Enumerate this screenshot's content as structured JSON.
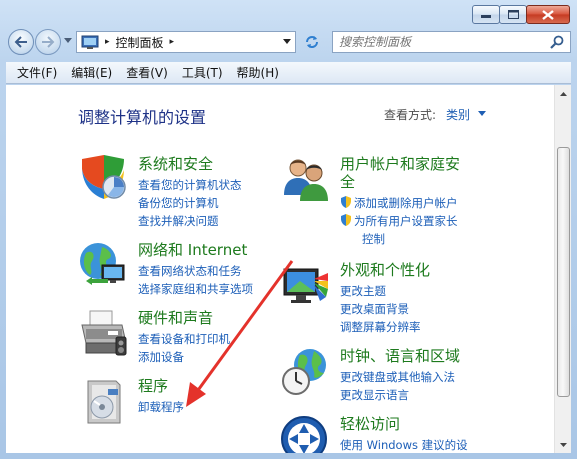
{
  "window": {
    "nav": {
      "back": "back",
      "forward": "forward"
    },
    "address": {
      "crumb": "控制面板",
      "separator": "▸"
    },
    "search": {
      "placeholder": "搜索控制面板"
    }
  },
  "menubar": [
    {
      "label": "文件(F)"
    },
    {
      "label": "编辑(E)"
    },
    {
      "label": "查看(V)"
    },
    {
      "label": "工具(T)"
    },
    {
      "label": "帮助(H)"
    }
  ],
  "content": {
    "title": "调整计算机的设置",
    "view_by_label": "查看方式:",
    "view_by_value": "类别",
    "categories": [
      {
        "title": "系统和安全",
        "icon": "shield-system-icon",
        "links": [
          "查看您的计算机状态",
          "备份您的计算机",
          "查找并解决问题"
        ]
      },
      {
        "title": "网络和 Internet",
        "icon": "network-globe-icon",
        "links": [
          "查看网络状态和任务",
          "选择家庭组和共享选项"
        ]
      },
      {
        "title": "硬件和声音",
        "icon": "printer-icon",
        "links": [
          "查看设备和打印机",
          "添加设备"
        ]
      },
      {
        "title": "程序",
        "icon": "programs-icon",
        "links": [
          "卸载程序"
        ]
      },
      {
        "title_line1": "用户帐户和家庭安",
        "title_line2": "全",
        "icon": "users-icon",
        "links": [
          "添加或删除用户帐户",
          "为所有用户设置家长",
          "控制"
        ]
      },
      {
        "title": "外观和个性化",
        "icon": "monitor-appearance-icon",
        "links": [
          "更改主题",
          "更改桌面背景",
          "调整屏幕分辨率"
        ]
      },
      {
        "title": "时钟、语言和区域",
        "icon": "clock-globe-icon",
        "links": [
          "更改键盘或其他输入法",
          "更改显示语言"
        ]
      },
      {
        "title": "轻松访问",
        "icon": "ease-of-access-icon",
        "links": [
          "使用 Windows 建议的设"
        ]
      }
    ]
  },
  "colors": {
    "category_title": "#1d7a1d",
    "link": "#1d5fb8",
    "page_title": "#1e3287",
    "annotation_arrow": "#e4322b"
  }
}
